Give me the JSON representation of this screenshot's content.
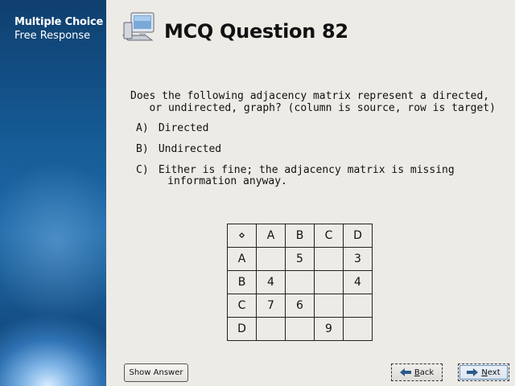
{
  "sidebar": {
    "items": [
      {
        "label": "Multiple Choice"
      },
      {
        "label": "Free Response"
      }
    ]
  },
  "header": {
    "icon": "computer-icon",
    "title": "MCQ Question 82"
  },
  "question": {
    "line1": "Does the following adjacency matrix represent a directed,",
    "line2": "   or undirected, graph? (column is source, row is target)"
  },
  "options": [
    {
      "label": "A)",
      "line1": "Directed",
      "line2": ""
    },
    {
      "label": "B)",
      "line1": "Undirected",
      "line2": ""
    },
    {
      "label": "C)",
      "line1": "Either is fine; the adjacency matrix is missing",
      "line2": "   information anyway."
    }
  ],
  "matrix": {
    "corner": "⋄",
    "headers": [
      "A",
      "B",
      "C",
      "D"
    ],
    "rows": [
      {
        "label": "A",
        "cells": [
          "",
          "5",
          "",
          "3"
        ]
      },
      {
        "label": "B",
        "cells": [
          "4",
          "",
          "",
          "4"
        ]
      },
      {
        "label": "C",
        "cells": [
          "7",
          "6",
          "",
          ""
        ]
      },
      {
        "label": "D",
        "cells": [
          "",
          "",
          "9",
          ""
        ]
      }
    ]
  },
  "buttons": {
    "show_answer": "Show Answer",
    "back_first": "B",
    "back_rest": "ack",
    "next_first": "N",
    "next_rest": "ext"
  }
}
